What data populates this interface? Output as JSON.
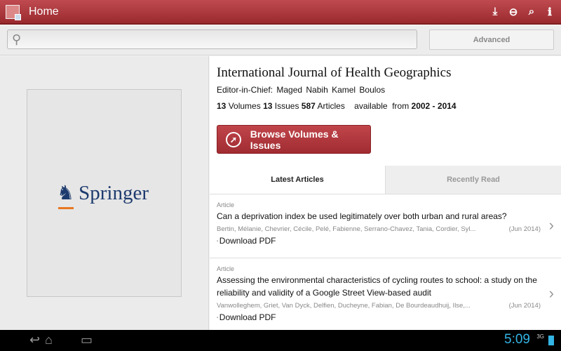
{
  "appbar": {
    "title": "Home"
  },
  "search": {
    "placeholder": "",
    "advanced": "Advanced"
  },
  "publisher": {
    "logo_text": "Springer"
  },
  "journal": {
    "title": "International Journal of Health Geographics",
    "editor": "Editor-in-Chief:  Maged  Nabih  Kamel  Boulos",
    "volumes": "13",
    "volumes_label": " Volumes ",
    "issues": "13",
    "issues_label": " Issues ",
    "articles": "587",
    "articles_label": " Articles    available  from ",
    "years": "2002 - 2014",
    "browse": "Browse Volumes & Issues"
  },
  "tabs": [
    {
      "label": "Latest Articles"
    },
    {
      "label": "Recently Read"
    }
  ],
  "articles": [
    {
      "kind": "Article",
      "title": "Can a deprivation index be used legitimately over both urban and rural areas?",
      "authors": "Bertin, Mélanie, Chevrier, Cécile, Pelé, Fabienne, Serrano-Chavez, Tania, Cordier, Syl...",
      "date": "(Jun 2014)",
      "download": "Download PDF"
    },
    {
      "kind": "Article",
      "title": "Assessing the environmental characteristics of cycling routes to school: a study on the reliability and validity of a Google Street View-based audit",
      "authors": "Vanwolleghem, Griet, Van Dyck, Delfien, Ducheyne, Fabian, De Bourdeaudhuij, Ilse,...",
      "date": "(Jun 2014)",
      "download": "Download PDF"
    }
  ],
  "status": {
    "time": "5:09",
    "network": "3G"
  }
}
